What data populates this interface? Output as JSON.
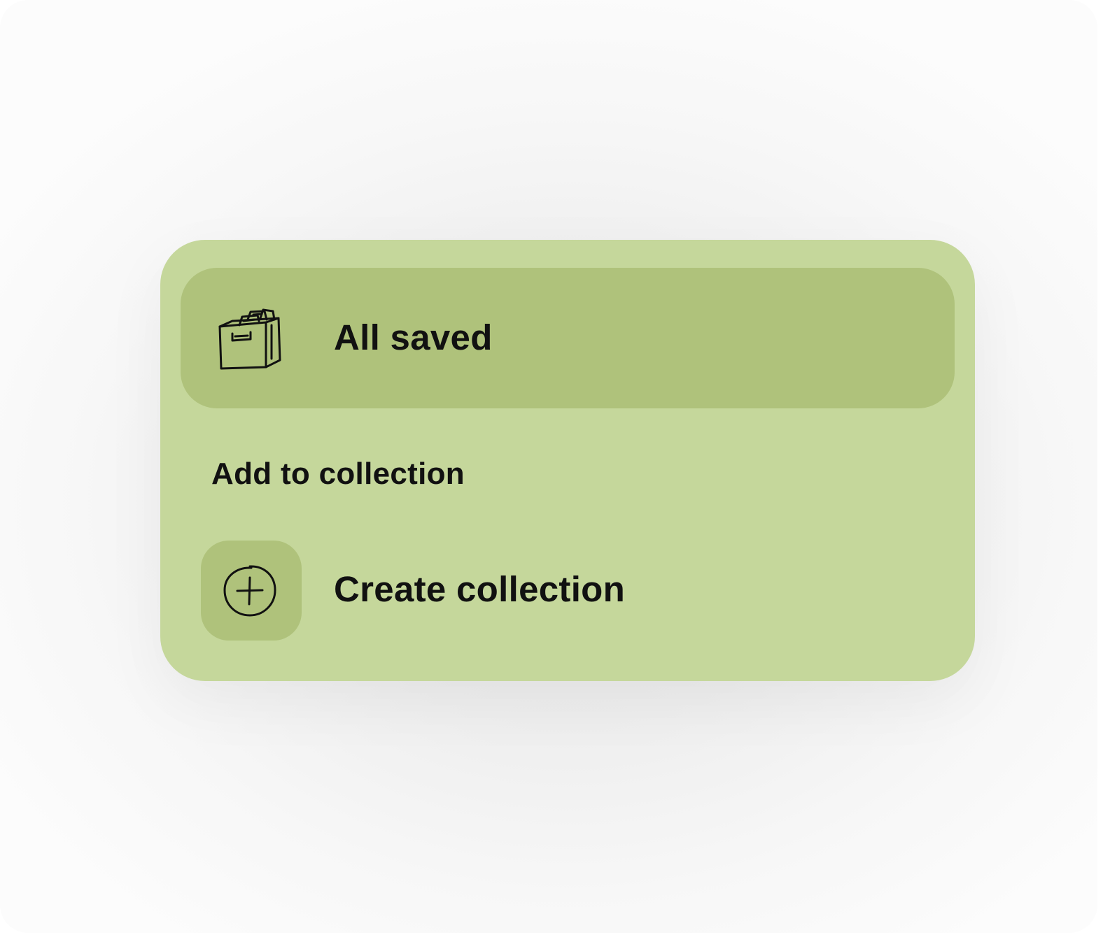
{
  "menu": {
    "all_saved": {
      "label": "All saved",
      "icon": "file-drawer-icon"
    },
    "section_title": "Add to collection",
    "create_collection": {
      "label": "Create collection",
      "icon": "plus-circle-icon"
    }
  },
  "colors": {
    "panel": "#c5d79b",
    "highlight": "#afc27b",
    "text": "#111111"
  }
}
